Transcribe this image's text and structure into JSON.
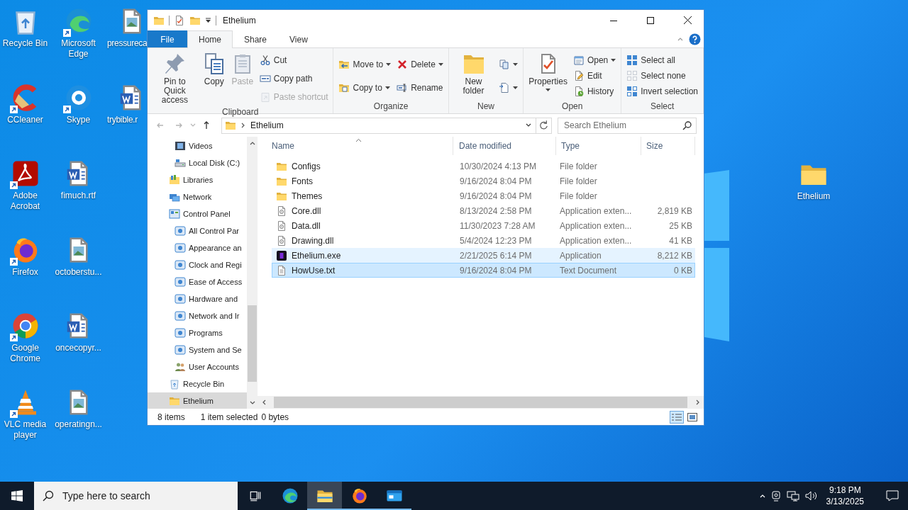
{
  "desktop": {
    "icons": [
      {
        "label": "Recycle Bin",
        "kind": "recycle-bin",
        "shortcut": false
      },
      {
        "label": "CCleaner",
        "kind": "ccleaner",
        "shortcut": true
      },
      {
        "label": "Adobe Acrobat",
        "kind": "acrobat",
        "shortcut": true
      },
      {
        "label": "Firefox",
        "kind": "firefox",
        "shortcut": true
      },
      {
        "label": "Google Chrome",
        "kind": "chrome",
        "shortcut": true
      },
      {
        "label": "VLC media player",
        "kind": "vlc",
        "shortcut": true
      },
      {
        "label": "Microsoft Edge",
        "kind": "edge",
        "shortcut": true
      },
      {
        "label": "Skype",
        "kind": "skype",
        "shortcut": true
      },
      {
        "label": "fimuch.rtf",
        "kind": "word-doc",
        "shortcut": false
      },
      {
        "label": "octoberstu...",
        "kind": "image-file",
        "shortcut": false
      },
      {
        "label": "oncecopyr...",
        "kind": "word-doc",
        "shortcut": false
      },
      {
        "label": "operatingn...",
        "kind": "image-file",
        "shortcut": false
      },
      {
        "label": "pressureca",
        "kind": "image-file",
        "shortcut": false
      },
      {
        "label": "trybible.r",
        "kind": "word-doc",
        "shortcut": false
      }
    ],
    "right_icons": [
      {
        "label": "Ethelium",
        "kind": "folder",
        "shortcut": false
      }
    ]
  },
  "window": {
    "title": "Ethelium",
    "ribbon_tabs": [
      {
        "label": "File",
        "kind": "file",
        "selected": false
      },
      {
        "label": "Home",
        "kind": "tab",
        "selected": true
      },
      {
        "label": "Share",
        "kind": "tab",
        "selected": false
      },
      {
        "label": "View",
        "kind": "tab",
        "selected": false
      }
    ],
    "ribbon_groups": [
      {
        "label": "Clipboard",
        "columns": [
          {
            "kind": "large",
            "buttons": [
              {
                "label": "Pin to Quick access",
                "kind": "pin",
                "disabled": false,
                "dropdown": false
              }
            ]
          },
          {
            "kind": "large",
            "buttons": [
              {
                "label": "Copy",
                "kind": "copy",
                "disabled": false,
                "dropdown": false
              }
            ]
          },
          {
            "kind": "large",
            "buttons": [
              {
                "label": "Paste",
                "kind": "paste",
                "disabled": true,
                "dropdown": false
              }
            ]
          },
          {
            "kind": "stack",
            "buttons": [
              {
                "label": "Cut",
                "kind": "cut",
                "disabled": false,
                "dropdown": false
              },
              {
                "label": "Copy path",
                "kind": "copy-path",
                "disabled": false,
                "dropdown": false
              },
              {
                "label": "Paste shortcut",
                "kind": "paste-shortcut",
                "disabled": true,
                "dropdown": false
              }
            ]
          }
        ]
      },
      {
        "label": "Organize",
        "columns": [
          {
            "kind": "stack",
            "buttons": [
              {
                "label": "Move to",
                "kind": "move-to",
                "disabled": false,
                "dropdown": true
              },
              {
                "label": "Copy to",
                "kind": "copy-to",
                "disabled": false,
                "dropdown": true
              }
            ]
          },
          {
            "kind": "stack",
            "buttons": [
              {
                "label": "Delete",
                "kind": "delete",
                "disabled": false,
                "dropdown": true
              },
              {
                "label": "Rename",
                "kind": "rename",
                "disabled": false,
                "dropdown": false
              }
            ]
          }
        ]
      },
      {
        "label": "New",
        "columns": [
          {
            "kind": "large",
            "buttons": [
              {
                "label": "New folder",
                "kind": "new-folder",
                "disabled": false,
                "dropdown": false
              }
            ]
          },
          {
            "kind": "stack",
            "buttons": [
              {
                "kind": "new-item",
                "disabled": false,
                "dropdown": true
              },
              {
                "kind": "easy-access",
                "disabled": false,
                "dropdown": true
              }
            ]
          }
        ]
      },
      {
        "label": "Open",
        "columns": [
          {
            "kind": "large",
            "buttons": [
              {
                "label": "Properties",
                "kind": "properties",
                "disabled": false,
                "dropdown": true
              }
            ]
          },
          {
            "kind": "stack",
            "buttons": [
              {
                "label": "Open",
                "kind": "open",
                "disabled": false,
                "dropdown": true
              },
              {
                "label": "Edit",
                "kind": "edit",
                "disabled": false,
                "dropdown": false
              },
              {
                "label": "History",
                "kind": "history",
                "disabled": false,
                "dropdown": false
              }
            ]
          }
        ]
      },
      {
        "label": "Select",
        "columns": [
          {
            "kind": "stack",
            "buttons": [
              {
                "label": "Select all",
                "kind": "select-all",
                "disabled": false,
                "dropdown": false
              },
              {
                "label": "Select none",
                "kind": "select-none",
                "disabled": false,
                "dropdown": false
              },
              {
                "label": "Invert selection",
                "kind": "invert-selection",
                "disabled": false,
                "dropdown": false
              }
            ]
          }
        ]
      }
    ],
    "address": {
      "path": [
        "Ethelium"
      ]
    },
    "search": {
      "placeholder": "Search Ethelium"
    },
    "nav_pane": {
      "top_children": [
        {
          "label": "Videos",
          "kind": "videos",
          "selected": false
        },
        {
          "label": "Local Disk (C:)",
          "kind": "disk",
          "selected": false
        }
      ],
      "items": [
        {
          "label": "Libraries",
          "kind": "libraries",
          "selected": false
        },
        {
          "label": "Network",
          "kind": "network",
          "selected": false
        },
        {
          "label": "Control Panel",
          "kind": "control-panel",
          "selected": false,
          "children": [
            {
              "label": "All Control Par",
              "kind": "applet",
              "selected": false
            },
            {
              "label": "Appearance an",
              "kind": "applet",
              "selected": false
            },
            {
              "label": "Clock and Regi",
              "kind": "applet",
              "selected": false
            },
            {
              "label": "Ease of Access",
              "kind": "applet",
              "selected": false
            },
            {
              "label": "Hardware and",
              "kind": "applet",
              "selected": false
            },
            {
              "label": "Network and Ir",
              "kind": "applet",
              "selected": false
            },
            {
              "label": "Programs",
              "kind": "applet",
              "selected": false
            },
            {
              "label": "System and Se",
              "kind": "applet",
              "selected": false
            },
            {
              "label": "User Accounts",
              "kind": "users",
              "selected": false
            }
          ]
        },
        {
          "label": "Recycle Bin",
          "kind": "recycle-bin",
          "selected": false
        },
        {
          "label": "Ethelium",
          "kind": "folder",
          "selected": true
        }
      ]
    },
    "columns": [
      "Name",
      "Date modified",
      "Type",
      "Size"
    ],
    "files": [
      {
        "kind": "folder",
        "name": "Configs",
        "date": "10/30/2024 4:13 PM",
        "type": "File folder",
        "selected": false,
        "hovered": false
      },
      {
        "kind": "folder",
        "name": "Fonts",
        "date": "9/16/2024 8:04 PM",
        "type": "File folder",
        "selected": false,
        "hovered": false
      },
      {
        "kind": "folder",
        "name": "Themes",
        "date": "9/16/2024 8:04 PM",
        "type": "File folder",
        "selected": false,
        "hovered": false
      },
      {
        "kind": "dll",
        "name": "Core.dll",
        "date": "8/13/2024 2:58 PM",
        "type": "Application exten...",
        "size": "2,819 KB",
        "selected": false,
        "hovered": false
      },
      {
        "kind": "dll",
        "name": "Data.dll",
        "date": "11/30/2023 7:28 AM",
        "type": "Application exten...",
        "size": "25 KB",
        "selected": false,
        "hovered": false
      },
      {
        "kind": "dll",
        "name": "Drawing.dll",
        "date": "5/4/2024 12:23 PM",
        "type": "Application exten...",
        "size": "41 KB",
        "selected": false,
        "hovered": false
      },
      {
        "kind": "exe",
        "name": "Ethelium.exe",
        "date": "2/21/2025 6:14 PM",
        "type": "Application",
        "size": "8,212 KB",
        "selected": false,
        "hovered": true
      },
      {
        "kind": "doc",
        "name": "HowUse.txt",
        "date": "9/16/2024 8:04 PM",
        "type": "Text Document",
        "size": "0 KB",
        "selected": true,
        "hovered": false
      }
    ],
    "status": {
      "count": "8 items",
      "selection": "1 item selected",
      "bytes": "0 bytes"
    },
    "views": [
      {
        "kind": "details",
        "selected": true
      },
      {
        "kind": "large-icons",
        "selected": false
      }
    ]
  },
  "taskbar": {
    "search": {
      "placeholder": "Type here to search"
    },
    "apps": [
      {
        "kind": "task-view",
        "selected": false,
        "running": false
      },
      {
        "kind": "edge",
        "selected": false,
        "running": false
      },
      {
        "kind": "explorer",
        "selected": true,
        "running": true
      },
      {
        "kind": "firefox",
        "selected": false,
        "running": true
      },
      {
        "kind": "app",
        "selected": false,
        "running": true
      }
    ],
    "time": "9:18 PM",
    "date": "3/13/2025"
  }
}
